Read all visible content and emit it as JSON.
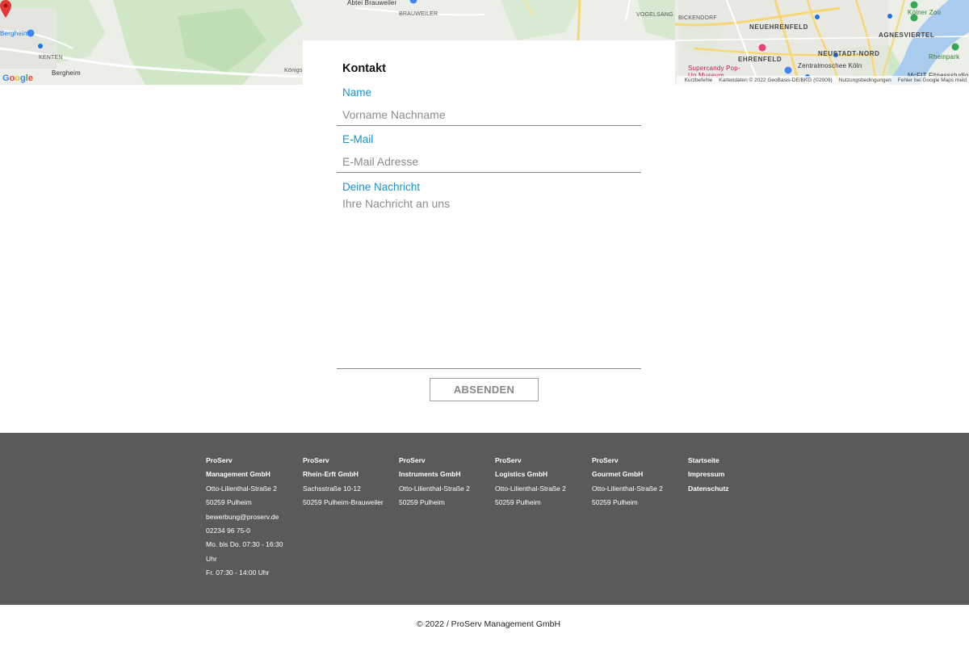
{
  "map": {
    "labels": {
      "bergheim_poi": "Bergheim",
      "kenten": "KENTEN",
      "bergheim": "Bergheim",
      "koenige": "Königs",
      "abtei": "Abtei Brauweiler",
      "brauweiler": "BRAUWEILER",
      "vogelsang": "VOGELSANG",
      "bickendorf": "BICKENDORF",
      "neuehrenfeld": "NEUEHRENFELD",
      "agnesviertel": "AGNESVIERTEL",
      "koelner_zoo": "Kölner Zoo",
      "ehrenfeld": "EHRENFELD",
      "neustadt_nord": "NEUSTADT-NORD",
      "supercandy": "Supercandy Pop-Up Museum",
      "zentralmoschee": "Zentralmoschee Köln",
      "rheinpark": "Rheinpark",
      "mcfit": "McFIT Fitnessstudio"
    },
    "attribution": {
      "shortcuts": "Kurzbefehle",
      "data": "Kartendaten © 2022 GeoBasis-DE/BKG (©2009)",
      "terms": "Nutzungsbedingungen",
      "report": "Fehler bei Google Maps meld"
    },
    "google_logo": [
      "G",
      "o",
      "o",
      "g",
      "l",
      "e"
    ]
  },
  "contact": {
    "title": "Kontakt",
    "name_label": "Name",
    "name_placeholder": "Vorname Nachname",
    "email_label": "E-Mail",
    "email_placeholder": "E-Mail Adresse",
    "message_label": "Deine Nachricht",
    "message_placeholder": "Ihre Nachricht an uns",
    "submit_label": "ABSENDEN"
  },
  "footer": {
    "columns": [
      {
        "brand": "ProServ",
        "company": "Management GmbH",
        "lines": [
          "Otto-Lilienthal-Straße 2",
          "50259 Pulheim",
          "bewerbung@proserv.de",
          "02234 96 75-0",
          "Mo. bis Do. 07:30 - 16:30",
          "Uhr",
          "Fr. 07:30 - 14:00 Uhr"
        ]
      },
      {
        "brand": "ProServ",
        "company": "Rhein-Erft GmbH",
        "lines": [
          "Sachsstraße 10-12",
          "50259 Pulheim-Brauweiler"
        ]
      },
      {
        "brand": "ProServ",
        "company": "Instruments GmbH",
        "lines": [
          "Otto-Lilienthal-Straße 2",
          "50259 Pulheim"
        ]
      },
      {
        "brand": "ProServ",
        "company": "Logistics GmbH",
        "lines": [
          "Otto-Lilienthal-Straße 2",
          "50259 Pulheim"
        ]
      },
      {
        "brand": "ProServ",
        "company": "Gourmet GmbH",
        "lines": [
          "Otto-Lilienthal-Straße 2",
          "50259 Pulheim"
        ]
      }
    ],
    "links": [
      "Startseite",
      "Impressum",
      "Datenschutz"
    ],
    "copyright": "© 2022 / ProServ Management GmbH"
  },
  "colors": {
    "accent": "#1a93c8",
    "footer_bg": "#5a5a5a",
    "map_pin": "#e53935"
  }
}
